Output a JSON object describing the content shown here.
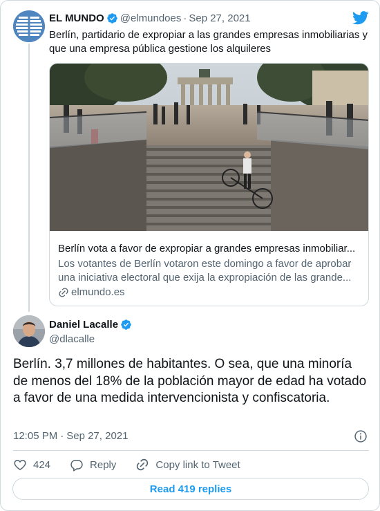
{
  "quoted_tweet": {
    "name": "EL MUNDO",
    "handle": "@elmundoes",
    "separator": "·",
    "date": "Sep 27, 2021",
    "text": "Berlín, partidario de expropiar a las grandes empresas inmobiliarias y que una empresa pública gestione los alquileres",
    "link_card": {
      "title": "Berlín vota a favor de expropiar a grandes empresas inmobiliar...",
      "description_line1": "Los votantes de Berlín votaron este domingo a favor de aprobar",
      "description_line2": "una iniciativa electoral que exija la expropiación de las grande...",
      "domain": "elmundo.es"
    }
  },
  "main_tweet": {
    "name": "Daniel Lacalle",
    "handle": "@dlacalle",
    "text": "Berlín. 3,7 millones de habitantes. O sea, que una minoría de menos del 18% de la población mayor de edad ha votado a favor de una medida intervencionista y confiscatoria.",
    "time": "12:05 PM",
    "separator": "·",
    "date": "Sep 27, 2021"
  },
  "actions": {
    "like_count": "424",
    "reply_label": "Reply",
    "copy_label": "Copy link to Tweet"
  },
  "read_replies_label": "Read 419 replies",
  "colors": {
    "accent": "#1d9bf0",
    "text_primary": "#0f1419",
    "text_secondary": "#536471",
    "border": "#cfd9de"
  },
  "icons": [
    "verified-badge-icon",
    "twitter-bird-icon",
    "link-icon",
    "info-icon",
    "heart-icon",
    "reply-bubble-icon",
    "copy-link-icon"
  ]
}
